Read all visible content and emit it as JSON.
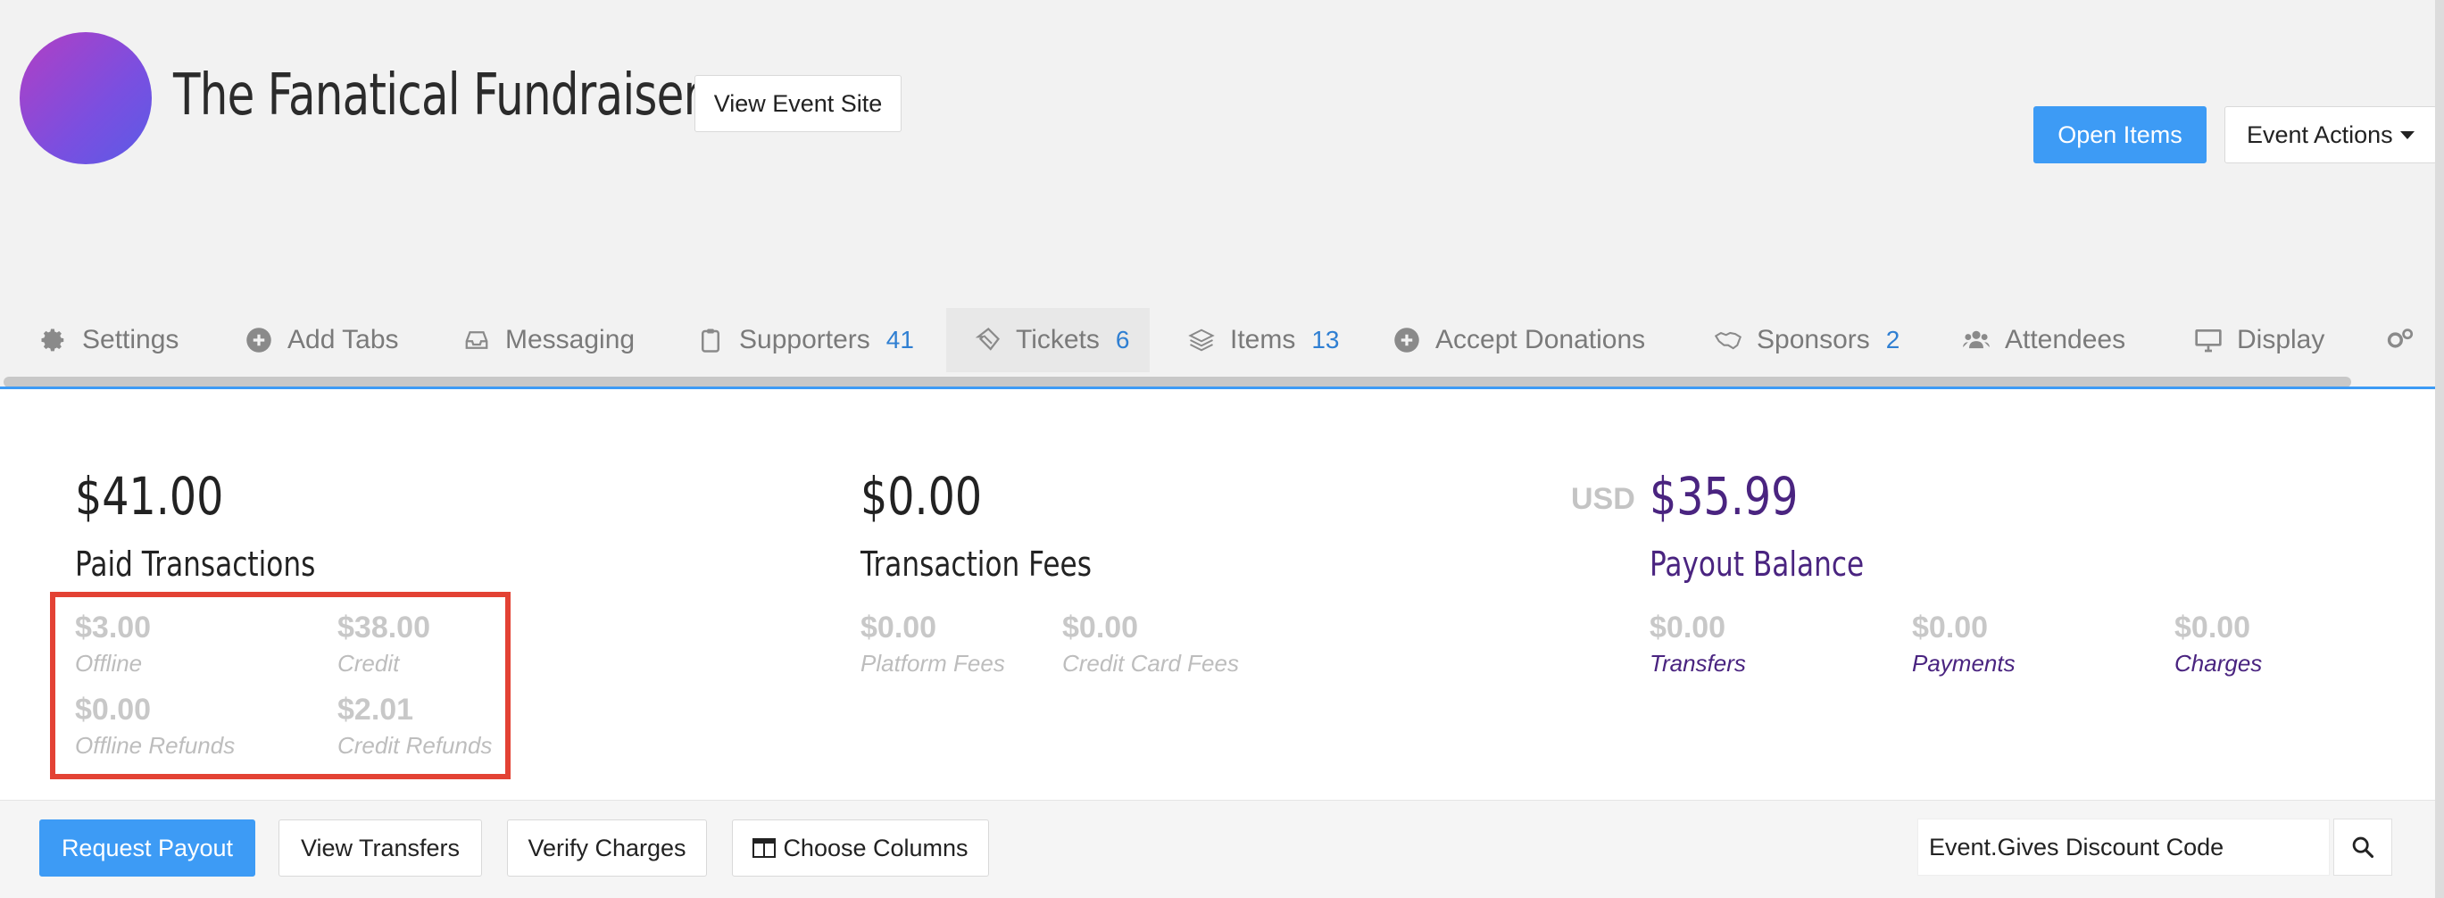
{
  "header": {
    "title": "The Fanatical Fundraiser",
    "view_event_site": "View Event Site",
    "open_items": "Open Items",
    "event_actions": "Event Actions"
  },
  "tabs": [
    {
      "label": "Settings",
      "icon": "gear-icon"
    },
    {
      "label": "Add Tabs",
      "icon": "plus-circle-icon"
    },
    {
      "label": "Messaging",
      "icon": "inbox-icon"
    },
    {
      "label": "Supporters",
      "count": "41",
      "icon": "clipboard-icon"
    },
    {
      "label": "Tickets",
      "count": "6",
      "icon": "ticket-icon"
    },
    {
      "label": "Items",
      "count": "13",
      "icon": "layers-icon"
    },
    {
      "label": "Accept Donations",
      "icon": "plus-circle-icon"
    },
    {
      "label": "Sponsors",
      "count": "2",
      "icon": "handshake-icon"
    },
    {
      "label": "Attendees",
      "icon": "users-icon"
    },
    {
      "label": "Display",
      "icon": "monitor-icon"
    }
  ],
  "summary": {
    "paid": {
      "value": "$41.00",
      "label": "Paid Transactions",
      "offline": {
        "value": "$3.00",
        "label": "Offline"
      },
      "credit": {
        "value": "$38.00",
        "label": "Credit"
      },
      "offline_refunds": {
        "value": "$0.00",
        "label": "Offline Refunds"
      },
      "credit_refunds": {
        "value": "$2.01",
        "label": "Credit Refunds"
      }
    },
    "fees": {
      "value": "$0.00",
      "label": "Transaction Fees",
      "platform": {
        "value": "$0.00",
        "label": "Platform Fees"
      },
      "credit_card": {
        "value": "$0.00",
        "label": "Credit Card Fees"
      }
    },
    "payout": {
      "currency": "USD",
      "value": "$35.99",
      "label": "Payout Balance",
      "transfers": {
        "value": "$0.00",
        "label": "Transfers"
      },
      "payments": {
        "value": "$0.00",
        "label": "Payments"
      },
      "charges": {
        "value": "$0.00",
        "label": "Charges"
      }
    }
  },
  "footer": {
    "request_payout": "Request Payout",
    "view_transfers": "View Transfers",
    "verify_charges": "Verify Charges",
    "choose_columns": "Choose Columns",
    "discount_value": "Event.Gives Discount Code"
  },
  "colors": {
    "accent": "#3d9bf5",
    "purple": "#4a2480",
    "highlight": "#e34234"
  }
}
